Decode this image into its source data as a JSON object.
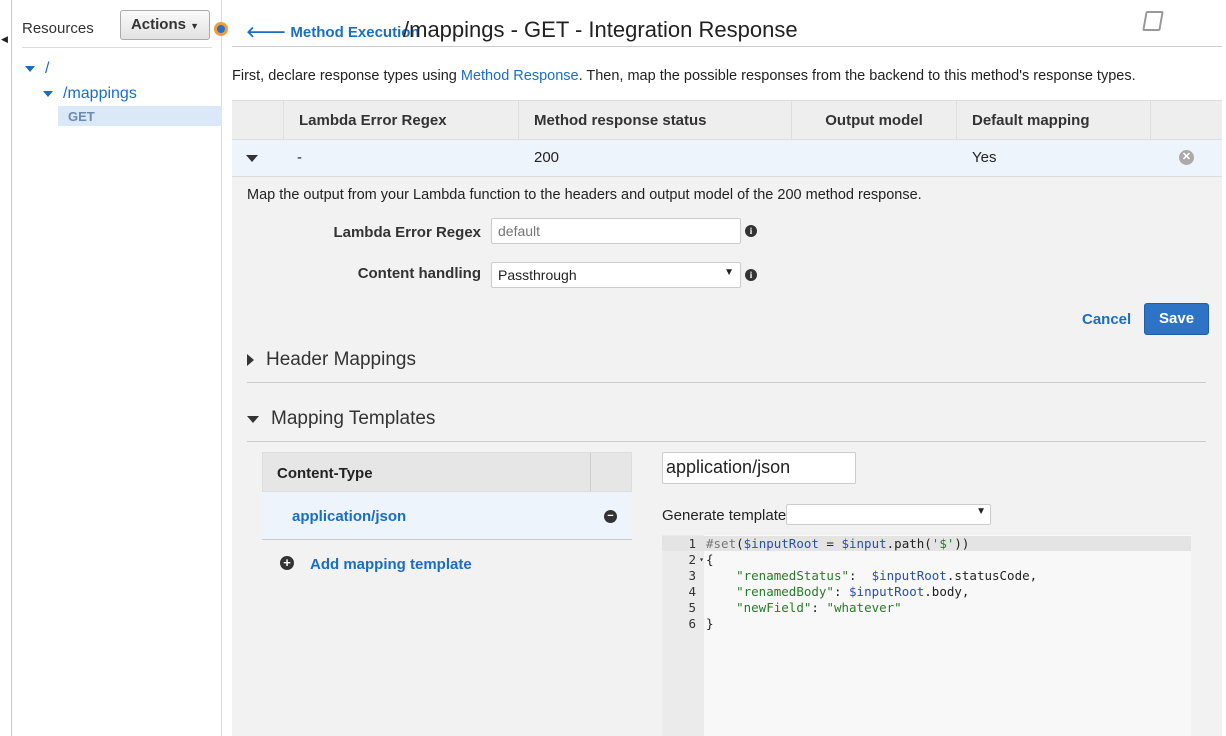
{
  "sidebar": {
    "title": "Resources",
    "actions_label": "Actions",
    "tree": [
      {
        "label": "/"
      },
      {
        "label": "/mappings"
      },
      {
        "label": "GET"
      }
    ]
  },
  "header": {
    "back_link": "Method Execution",
    "title": "/mappings - GET - Integration Response"
  },
  "intro": {
    "before": "First, declare response types using ",
    "link": "Method Response",
    "after": ". Then, map the possible responses from the backend to this method's response types."
  },
  "table": {
    "columns": [
      "Lambda Error Regex",
      "Method response status",
      "Output model",
      "Default mapping"
    ],
    "row": {
      "regex": "-",
      "status": "200",
      "model": "",
      "default": "Yes"
    }
  },
  "detail": {
    "description": "Map the output from your Lambda function to the headers and output model of the 200 method response.",
    "regex_label": "Lambda Error Regex",
    "regex_placeholder": "default",
    "content_label": "Content handling",
    "content_value": "Passthrough",
    "cancel": "Cancel",
    "save": "Save"
  },
  "header_mappings": "Header Mappings",
  "mapping_templates": {
    "title": "Mapping Templates",
    "content_type_header": "Content-Type",
    "items": [
      "application/json"
    ],
    "add_label": "Add mapping template",
    "selected": "application/json",
    "generate_label": "Generate template:",
    "generate_value": ""
  },
  "code": {
    "lines": [
      "1",
      "2",
      "3",
      "4",
      "5",
      "6"
    ]
  }
}
